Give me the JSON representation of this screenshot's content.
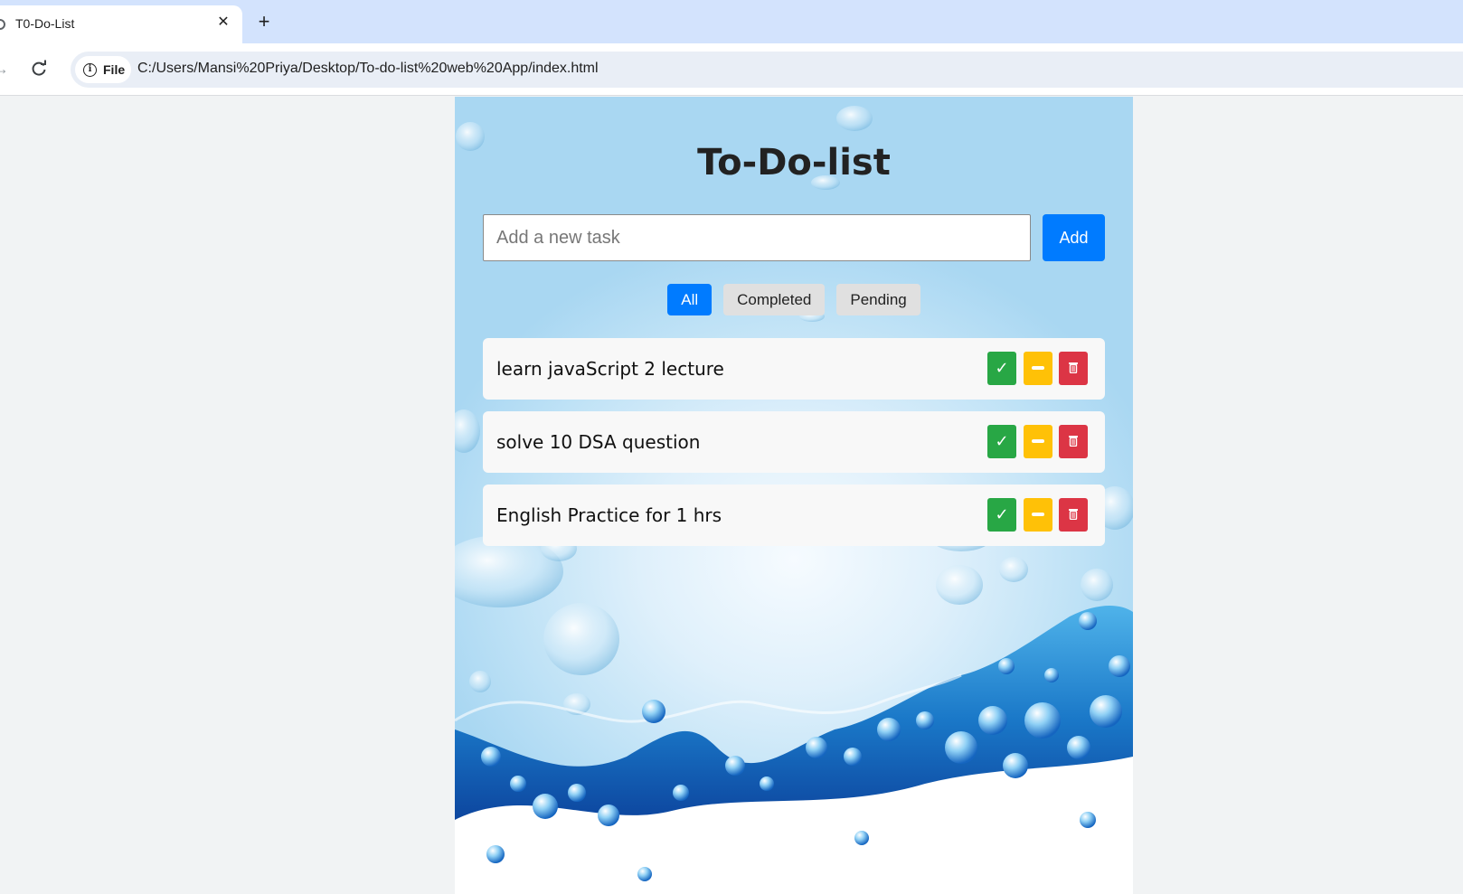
{
  "browser": {
    "tab_title": "T0-Do-List",
    "tab_close_glyph": "✕",
    "new_tab_glyph": "+",
    "site_chip_label": "File",
    "url": "C:/Users/Mansi%20Priya/Desktop/To-do-list%20web%20App/index.html",
    "icons": [
      "globe-icon",
      "close-icon",
      "plus-icon",
      "forward-icon",
      "reload-icon",
      "info-icon"
    ]
  },
  "app": {
    "title": "To-Do-list",
    "input_placeholder": "Add a new task",
    "add_label": "Add",
    "filters": [
      "All",
      "Completed",
      "Pending"
    ],
    "active_filter": "All",
    "tasks": [
      {
        "text": "learn javaScript 2 lecture"
      },
      {
        "text": "solve 10 DSA question"
      },
      {
        "text": "English Practice for 1 hrs"
      }
    ],
    "task_actions": {
      "complete_glyph": "✓",
      "delete_glyph": "🗑",
      "icons": [
        "check-icon",
        "minus-icon",
        "trash-icon"
      ]
    },
    "colors": {
      "primary": "#007bff",
      "complete": "#28a745",
      "pending": "#ffc107",
      "delete": "#dc3545",
      "water_dark": "#1565c0"
    }
  }
}
